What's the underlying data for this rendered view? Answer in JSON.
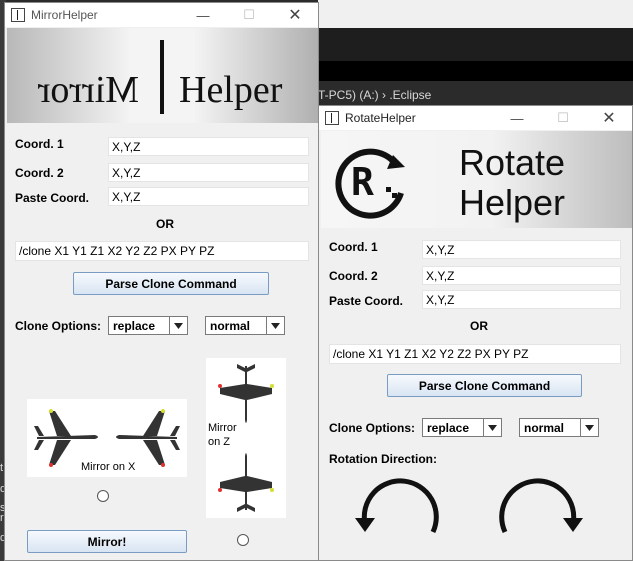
{
  "background": {
    "explorer_path": "T-PC5) (A:)  ›  .Eclipse",
    "left_fragments": [
      "t",
      "d",
      "s",
      "r",
      "d"
    ]
  },
  "mirror_window": {
    "title": "MirrorHelper",
    "banner_left": "Mirror",
    "banner_right": "Helper",
    "coord1_label": "Coord. 1",
    "coord1_value": "X,Y,Z",
    "coord2_label": "Coord. 2",
    "coord2_value": "X,Y,Z",
    "paste_label": "Paste Coord.",
    "paste_value": "X,Y,Z",
    "or_label": "OR",
    "clone_command": "/clone X1 Y1 Z1 X2 Y2 Z2 PX PY PZ",
    "parse_button": "Parse Clone Command",
    "clone_options_label": "Clone Options:",
    "mask_mode": "replace",
    "clone_mode": "normal",
    "mirror_x_caption": "Mirror on X",
    "mirror_z_caption_1": "Mirror",
    "mirror_z_caption_2": "on Z",
    "mirror_button": "Mirror!"
  },
  "rotate_window": {
    "title": "RotateHelper",
    "banner_line1": "Rotate",
    "banner_line2": "Helper",
    "coord1_label": "Coord. 1",
    "coord1_value": "X,Y,Z",
    "coord2_label": "Coord. 2",
    "coord2_value": "X,Y,Z",
    "paste_label": "Paste Coord.",
    "paste_value": "X,Y,Z",
    "or_label": "OR",
    "clone_command": "/clone X1 Y1 Z1 X2 Y2 Z2 PX PY PZ",
    "parse_button": "Parse Clone Command",
    "clone_options_label": "Clone Options:",
    "mask_mode": "replace",
    "clone_mode": "normal",
    "rotation_label": "Rotation Direction:"
  },
  "colors": {
    "window_bg": "#f0f0f0",
    "button_border": "#7a9cc3",
    "plane": "#333333",
    "wing_tip_red": "#e03030",
    "wing_tip_yellow": "#d4e030"
  }
}
